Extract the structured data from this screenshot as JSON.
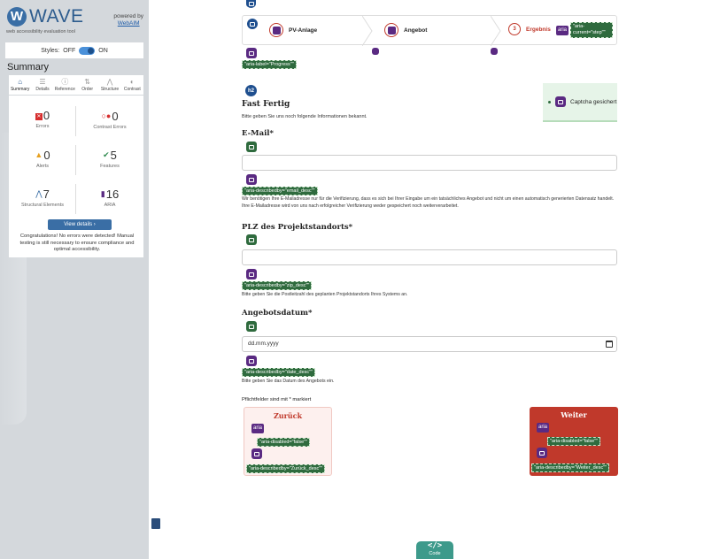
{
  "wave": {
    "title": "WAVE",
    "tagline": "web accessibility evaluation tool",
    "powered_by": "powered by",
    "powered_link": "WebAIM",
    "styles_label": "Styles:",
    "styles_off": "OFF",
    "styles_on": "ON",
    "summary_heading": "Summary",
    "tabs": [
      {
        "label": "Summary",
        "icon": "home-icon"
      },
      {
        "label": "Details",
        "icon": "list-icon"
      },
      {
        "label": "Reference",
        "icon": "info-icon"
      },
      {
        "label": "Order",
        "icon": "order-icon"
      },
      {
        "label": "Structure",
        "icon": "structure-icon"
      },
      {
        "label": "Contrast",
        "icon": "contrast-icon"
      }
    ],
    "stats": {
      "errors": {
        "count": "0",
        "label": "Errors"
      },
      "contrast_errors": {
        "count": "0",
        "label": "Contrast Errors"
      },
      "alerts": {
        "count": "0",
        "label": "Alerts"
      },
      "features": {
        "count": "5",
        "label": "Features"
      },
      "structural": {
        "count": "7",
        "label": "Structural Elements"
      },
      "aria": {
        "count": "16",
        "label": "ARIA"
      }
    },
    "view_details": "View details ›",
    "note": "Congratulations! No errors were detected! Manual testing is still necessary to ensure compliance and optimal accessibility."
  },
  "page": {
    "aria_progress_tag": "\"aria-label=\"Progress\"\"",
    "steps": [
      {
        "label": "PV-Anlage"
      },
      {
        "label": "Angebot"
      },
      {
        "label": "Ergebnis",
        "number": "3",
        "aria_current": "\"aria-current=\"step\"\""
      }
    ],
    "aria_badge_text": "aria",
    "heading": "Fast Fertig",
    "intro": "Bitte geben Sie uns noch folgende Informationen bekannt.",
    "captcha": "Captcha gesichert",
    "email": {
      "label": "E-Mail*",
      "value": "",
      "aria_tag": "\"aria-describedby=\"email_desc\"\"",
      "help": "Wir benötigen Ihre E-Mailadresse nur für die Verifizierung, dass es sich bei Ihrer Eingabe um ein tatsächliches Angebot und nicht um einen automatisch generierten Datensatz handelt. Ihre E-Mailadresse wird von uns nach erfolgreicher Verifizierung weder gespeichert noch weiterverarbeitet."
    },
    "zip": {
      "label": "PLZ des Projektstandorts*",
      "value": "",
      "aria_tag": "\"aria-describedby=\"zip_desc\"\"",
      "help": "Bitte geben Sie die Postleitzahl des geplanten Projektstandorts Ihres Systems an."
    },
    "date": {
      "label": "Angebotsdatum*",
      "value": "dd.mm.yyyy",
      "aria_tag": "\"aria-describedby=\"date_desc\"\"",
      "help": "Bitte geben Sie das Datum des Angebots ein."
    },
    "required_note": "Pflichtfelder sind mit * markiert",
    "back": {
      "label": "Zurück",
      "aria_disabled": "\"aria-disabled=\"false\"\"",
      "aria_describedby": "\"aria-describedby=\"Zurück_desc\"\""
    },
    "next": {
      "label": "Weiter",
      "aria_disabled": "\"aria-disabled=\"false\"\"",
      "aria_describedby": "\"aria-describedby=\"Weiter_desc\"\""
    },
    "code_label": "Code",
    "code_icon": "</>"
  }
}
